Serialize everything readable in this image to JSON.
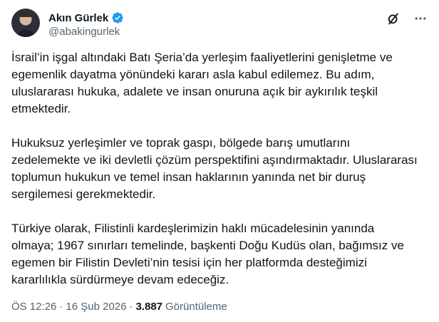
{
  "author": {
    "display_name": "Akın Gürlek",
    "handle": "@abakingurlek",
    "verified_icon": "verified-badge-icon",
    "verified_color": "#1d9bf0"
  },
  "header_actions": {
    "grok_icon": "grok-icon",
    "more_icon": "more-options-icon"
  },
  "tweet": {
    "paragraphs": [
      "İsrail’in işgal altındaki Batı Şeria’da yerleşim faaliyetlerini genişletme ve egemenlik dayatma yönündeki kararı asla kabul edilemez. Bu adım, uluslararası hukuka, adalete ve insan onuruna açık bir aykırılık teşkil etmektedir.",
      "Hukuksuz yerleşimler ve toprak gaspı, bölgede barış umutlarını zedelemekte ve iki devletli çözüm perspektifini aşındırmaktadır. Uluslararası toplumun hukukun ve temel insan haklarının yanında net bir duruş sergilemesi gerekmektedir.",
      "Türkiye olarak, Filistinli kardeşlerimizin haklı mücadelesinin yanında olmaya; 1967 sınırları temelinde, başkenti Doğu Kudüs olan, bağımsız ve egemen bir Filistin Devleti’nin tesisi için her platformda desteğimizi kararlılıkla sürdürmeye devam edeceğiz."
    ]
  },
  "meta": {
    "time": "ÖS 12:26",
    "separator": "·",
    "date": "16 Şub 2026",
    "views_count": "3.887",
    "views_label": "Görüntüleme"
  }
}
